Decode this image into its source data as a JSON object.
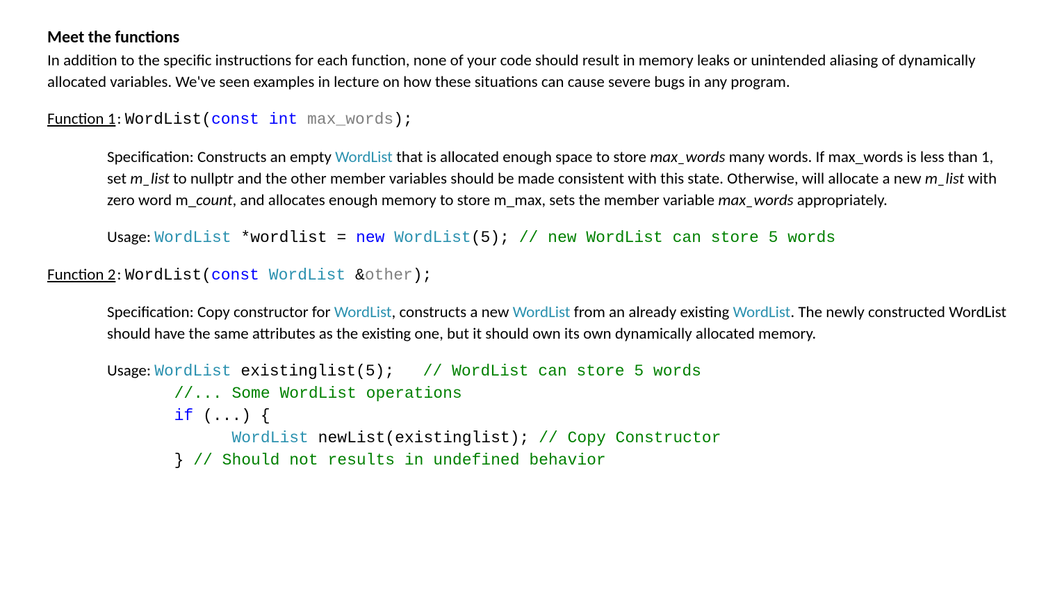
{
  "heading": "Meet the functions",
  "intro": "In addition to the specific instructions for each function, none of your code should result in memory leaks or unintended aliasing of dynamically allocated variables. We've seen examples in lecture on how these situations can cause severe bugs in any program.",
  "fn1": {
    "label": "Function 1",
    "sig_name": "WordList",
    "sig_open": "(",
    "sig_kw1": "const",
    "sig_sp1": " ",
    "sig_kw2": "int",
    "sig_sp2": " ",
    "sig_param": "max_words",
    "sig_close": ");",
    "colon": ": ",
    "spec": {
      "lead": "Specification: Constructs an empty ",
      "wl1": "WordList",
      "p1": " that is allocated enough space to store  ",
      "it1": "max_words",
      "p2": " many words.  If max_words is less than 1, set ",
      "it2": "m_list",
      "p3": " to nullptr and the other member variables should be made consistent with this state.  Otherwise, will allocate a new ",
      "it3": "m_list",
      "p4": " with zero word m_",
      "it4": "count",
      "p5": ", and allocates enough memory to store m_max, sets the member variable ",
      "it5": "max_words",
      "p6": " appropriately."
    },
    "usage_label": "Usage: ",
    "usage": {
      "type1": "WordList",
      "t1": " *wordlist = ",
      "kw_new": "new",
      "t2": " ",
      "type2": "WordList",
      "t3": "(5); ",
      "cmt": "// new WordList can store 5 words"
    }
  },
  "fn2": {
    "label": "Function 2",
    "colon": ": ",
    "sig_name": "WordList",
    "sig_open": "(",
    "sig_kw1": "const",
    "sig_sp1": " ",
    "sig_type": "WordList",
    "sig_sp2": " &",
    "sig_param": "other",
    "sig_close": ");",
    "spec": {
      "lead": "Specification: Copy constructor for ",
      "wl1": "WordList",
      "p1": ", constructs a new ",
      "wl2": "WordList",
      "p2": " from an already existing ",
      "wl3": "WordList",
      "p3": ".  The newly constructed WordList should have the same attributes as the existing one, but it should own its own dynamically allocated memory."
    },
    "usage_label": "Usage: ",
    "usage": {
      "l1_type": "WordList",
      "l1_text": " existinglist(5);   ",
      "l1_cmt": "// WordList can store 5 words",
      "l2_pad": "       ",
      "l2_cmt": "//... Some WordList operations",
      "l3_pad": "       ",
      "l3_kw": "if",
      "l3_rest": " (...) {",
      "l4_pad": "             ",
      "l4_type": "WordList",
      "l4_text": " newList(existinglist); ",
      "l4_cmt": "// Copy Constructor",
      "l5_pad": "       ",
      "l5_text": "} ",
      "l5_cmt": "// Should not results in undefined behavior"
    }
  }
}
